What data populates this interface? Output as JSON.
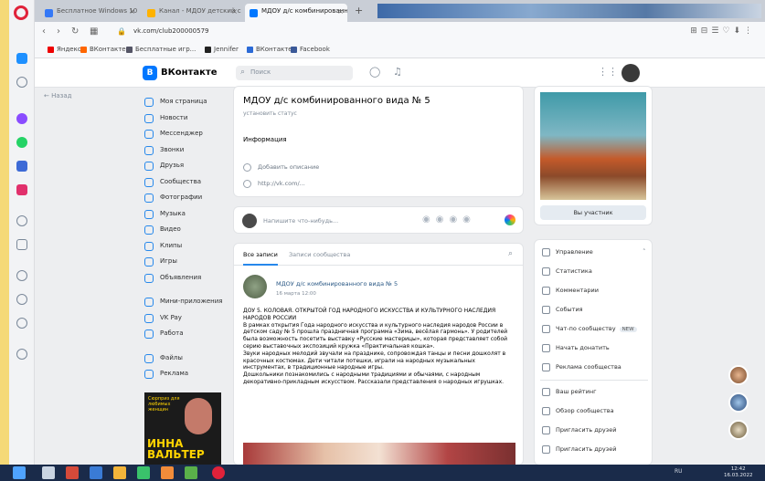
{
  "browser": {
    "tabs": [
      {
        "label": "Бесплатное Windows 10 в Ру",
        "active": false
      },
      {
        "label": "Канал - МДОУ детский с",
        "active": false
      },
      {
        "label": "МДОУ д/с комбинированного",
        "active": true
      }
    ],
    "url": "vk.com/club200000579",
    "bookmarks": [
      "Яндекс",
      "ВКонтакте",
      "Бесплатные игр...",
      "Jennifer",
      "ВКонтакте",
      "Facebook"
    ]
  },
  "vk": {
    "logo_text": "ВКонтакте",
    "search_placeholder": "Поиск",
    "back_link": "← Назад",
    "menu": [
      "Моя страница",
      "Новости",
      "Мессенджер",
      "Звонки",
      "Друзья",
      "Сообщества",
      "Фотографии",
      "Музыка",
      "Видео",
      "Клипы",
      "Игры",
      "Объявления"
    ],
    "menu_extra": [
      "Мини-приложения",
      "VK Pay",
      "Работа"
    ],
    "menu_extra2": [
      "Файлы",
      "Реклама"
    ],
    "promo": {
      "tagline": "Сюрприз для любимых женщин",
      "name_line1": "ИННА",
      "name_line2": "ВАЛЬТЕР"
    },
    "group": {
      "title": "МДОУ д/с комбинированного вида № 5",
      "status": "установить статус",
      "info_label": "Информация",
      "info_rows": [
        "Добавить описание",
        "http://vk.com/..."
      ]
    },
    "compose_placeholder": "Напишите что-нибудь...",
    "feed": {
      "tabs": [
        "Все записи",
        "Записи сообщества"
      ],
      "post": {
        "author": "МДОУ д/с комбинированного вида № 5",
        "date": "16 марта 12:00",
        "paragraphs": [
          "ДОУ 5. КОЛОВАЯ. ОТКРЫТОЙ ГОД НАРОДНОГО ИСКУССТВА И КУЛЬТУРНОГО НАСЛЕДИЯ НАРОДОВ РОССИИ",
          "В рамках открытия Года народного искусства и культурного наследия народов России в детском саду № 5 прошла праздничная программа «Зима, весёлая гармонь». У родителей была возможность посетить выставку «Русские мастерицы», которая представляет собой серию выставочных экспозиций кружка «Практичальная кошка».",
          "Звуки народных мелодий звучали на празднике, сопровождая танцы и песни дошколят в красочных костюмах. Дети читали потешки, играли на народных музыкальных инструментах, в традиционные народные игры.",
          "Дошкольники познакомились с народными традициями и обычаями, с народным декоративно-прикладным искусством. Рассказали представления о народных игрушках."
        ]
      }
    },
    "photo_button": "Вы участник",
    "actions": [
      {
        "label": "Управление",
        "badge": ""
      },
      {
        "label": "Статистика",
        "badge": ""
      },
      {
        "label": "Комментарии",
        "badge": ""
      },
      {
        "label": "События",
        "badge": ""
      },
      {
        "label": "Чат-по сообществу",
        "badge": "NEW"
      },
      {
        "label": "Начать донатить",
        "badge": ""
      },
      {
        "label": "Реклама сообщества",
        "badge": ""
      },
      {
        "label": "Ваш рейтинг",
        "badge": ""
      },
      {
        "label": "Обзор сообщества",
        "badge": ""
      },
      {
        "label": "Пригласить друзей",
        "badge": ""
      },
      {
        "label": "Пригласить друзей",
        "badge": ""
      }
    ]
  },
  "taskbar": {
    "tray": "RU",
    "time": "12:42",
    "date": "16.03.2022"
  },
  "colors": {
    "vk_blue": "#0077ff",
    "link": "#2a5885",
    "accent": "#2688eb",
    "frame": "#f5d977"
  }
}
